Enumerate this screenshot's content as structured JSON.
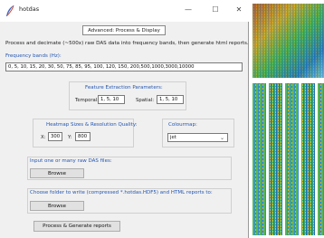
{
  "window": {
    "title": "hotdas",
    "minimize": "—",
    "maximize": "☐",
    "close": "✕"
  },
  "tab": {
    "label": "Advanced: Process & Display"
  },
  "description": "Process and decimate (~500x) raw DAS data into frequency bands, then generate html reports.",
  "frequency": {
    "label": "Frequency bands (Hz):",
    "value": "0, 5, 10, 15, 20, 30, 50, 75, 85, 95, 100, 120, 150, 200,500,1000,3000,10000"
  },
  "features": {
    "label": "Feature Extraction Parameters:",
    "temporal_label": "Temporal:",
    "temporal_value": "1, 5, 10",
    "spatial_label": "Spatial:",
    "spatial_value": "1, 5, 10"
  },
  "heatmap": {
    "label": "Heatmap Sizes & Resolution Quality:",
    "x_label": "X:",
    "x_value": "300",
    "y_label": "Y:",
    "y_value": "800"
  },
  "colourmap": {
    "label": "Colourmap:",
    "selected": "jet"
  },
  "input_files": {
    "label": "Input one or many raw DAS files:",
    "button": "Browse"
  },
  "output_folder": {
    "label": "Choose folder to write (compressed *.hotdas.HDF5) and HTML reports to:",
    "button": "Browse"
  },
  "process_button": "Process & Generate reports",
  "colors": {
    "accent": "#2456b0",
    "window_bg": "#f0f0f0"
  }
}
